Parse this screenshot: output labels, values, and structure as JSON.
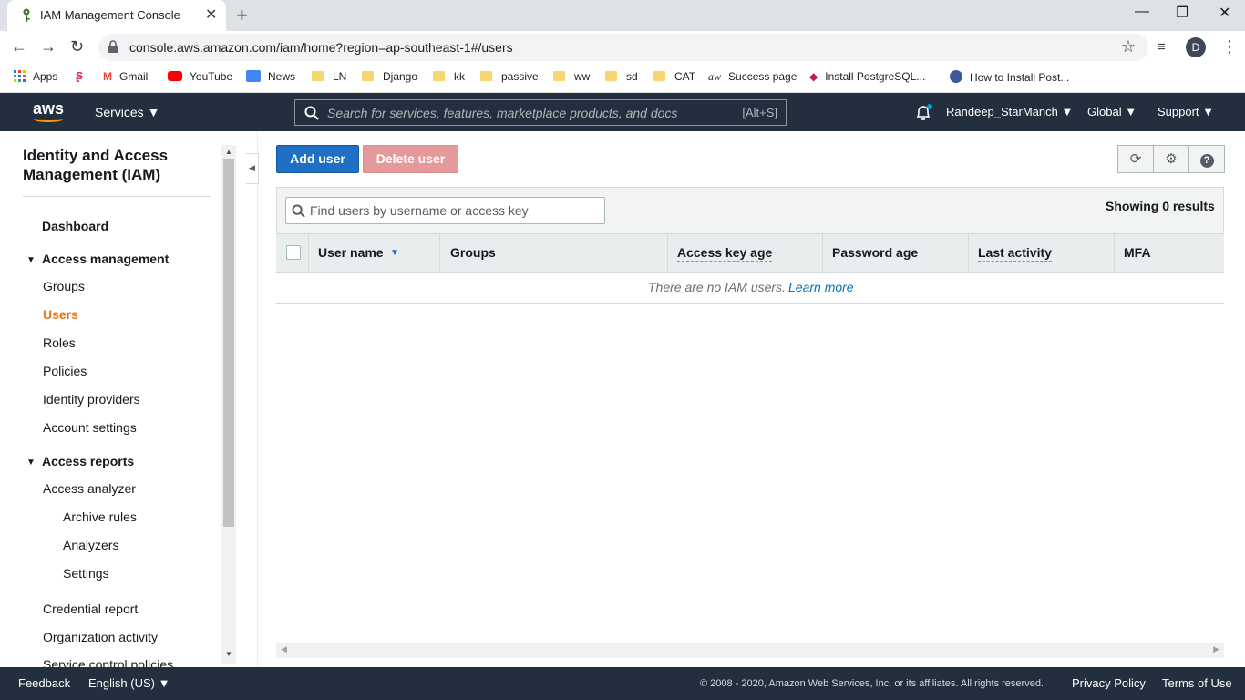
{
  "browser": {
    "tab_title": "IAM Management Console",
    "tab_close": "✕",
    "new_tab": "+",
    "url": "console.aws.amazon.com/iam/home?region=ap-southeast-1#/users",
    "profile_initial": "D",
    "window_controls": [
      "—",
      "❐",
      "✕"
    ],
    "bookmarks": [
      {
        "label": "Apps",
        "icon": "apps-grid-icon"
      },
      {
        "label": "",
        "icon": "s-logo-icon"
      },
      {
        "label": "Gmail",
        "icon": "gmail-icon"
      },
      {
        "label": "YouTube",
        "icon": "youtube-icon"
      },
      {
        "label": "News",
        "icon": "news-icon"
      },
      {
        "label": "LN",
        "icon": "folder-icon"
      },
      {
        "label": "Django",
        "icon": "folder-icon"
      },
      {
        "label": "kk",
        "icon": "folder-icon"
      },
      {
        "label": "passive",
        "icon": "folder-icon"
      },
      {
        "label": "ww",
        "icon": "folder-icon"
      },
      {
        "label": "sd",
        "icon": "folder-icon"
      },
      {
        "label": "CAT",
        "icon": "folder-icon"
      },
      {
        "label": "Success page",
        "icon": "aw-icon"
      },
      {
        "label": "Install PostgreSQL...",
        "icon": "graduation-cap-icon"
      },
      {
        "label": "How to Install Post...",
        "icon": "page-icon"
      }
    ]
  },
  "aws_nav": {
    "logo": "aws",
    "services": "Services",
    "search_placeholder": "Search for services, features, marketplace products, and docs",
    "search_hint": "[Alt+S]",
    "account": "Randeep_StarManch",
    "region": "Global",
    "support": "Support"
  },
  "sidebar": {
    "title": "Identity and Access Management (IAM)",
    "dashboard": "Dashboard",
    "access_management": "Access management",
    "access_management_items": [
      "Groups",
      "Users",
      "Roles",
      "Policies",
      "Identity providers",
      "Account settings"
    ],
    "active_item": "Users",
    "access_reports": "Access reports",
    "access_analyzer": "Access analyzer",
    "analyzer_items": [
      "Archive rules",
      "Analyzers",
      "Settings"
    ],
    "other_items": [
      "Credential report",
      "Organization activity",
      "Service control policies"
    ]
  },
  "main": {
    "add_user": "Add user",
    "delete_user": "Delete user",
    "filter_placeholder": "Find users by username or access key",
    "showing": "Showing 0 results",
    "columns": [
      "User name",
      "Groups",
      "Access key age",
      "Password age",
      "Last activity",
      "MFA"
    ],
    "empty_text": "There are no IAM users.",
    "learn_more": "Learn more"
  },
  "footer": {
    "feedback": "Feedback",
    "language": "English (US)",
    "copyright": "© 2008 - 2020, Amazon Web Services, Inc. or its affiliates. All rights reserved.",
    "privacy": "Privacy Policy",
    "terms": "Terms of Use"
  },
  "colors": {
    "aws_nav_bg": "#232f3e",
    "primary_button": "#1f6fc5",
    "delete_button": "#e6999a",
    "active_nav": "#ec7211",
    "link": "#0073bb"
  }
}
